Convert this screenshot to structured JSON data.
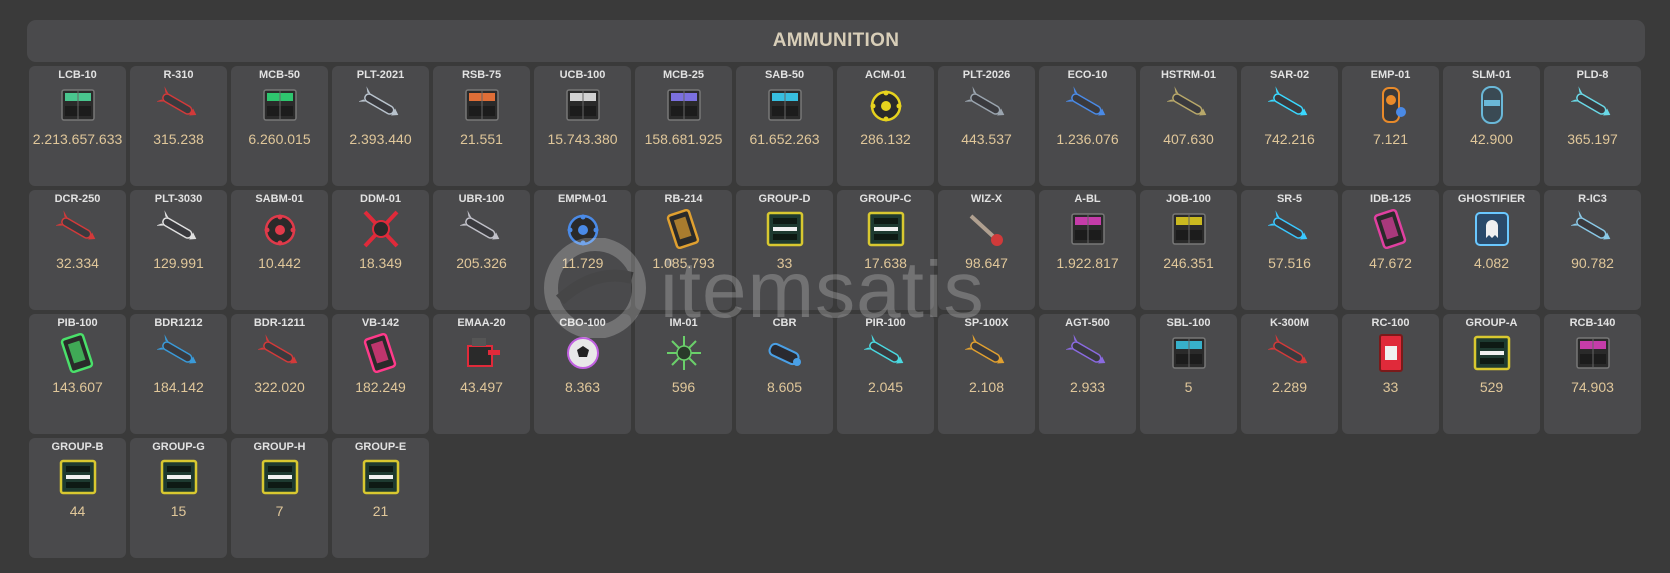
{
  "panel": {
    "title": "AMMUNITION"
  },
  "watermark": {
    "logo": "itemsatis-logo",
    "text": "itemsatis"
  },
  "colors": {
    "background": "#3a3a3a",
    "panel": "#4a4a4c",
    "title": "#d8ceb8",
    "item_name": "#e2e2e2",
    "quantity": "#e0c79a"
  },
  "items": [
    {
      "name": "LCB-10",
      "qty": "2.213.657.633",
      "icon": "crate-icon",
      "color": "#4fe0a0"
    },
    {
      "name": "R-310",
      "qty": "315.238",
      "icon": "missile-icon",
      "color": "#d23a3a"
    },
    {
      "name": "MCB-50",
      "qty": "6.260.015",
      "icon": "crate-icon",
      "color": "#2fe07a"
    },
    {
      "name": "PLT-2021",
      "qty": "2.393.440",
      "icon": "missile-icon",
      "color": "#b8c2cc"
    },
    {
      "name": "RSB-75",
      "qty": "21.551",
      "icon": "crate-icon",
      "color": "#ff7a3a"
    },
    {
      "name": "UCB-100",
      "qty": "15.743.380",
      "icon": "crate-icon",
      "color": "#f0f0f0"
    },
    {
      "name": "MCB-25",
      "qty": "158.681.925",
      "icon": "crate-icon",
      "color": "#8a7cff"
    },
    {
      "name": "SAB-50",
      "qty": "61.652.263",
      "icon": "crate-icon",
      "color": "#3ad8ff"
    },
    {
      "name": "ACM-01",
      "qty": "286.132",
      "icon": "mine-icon",
      "color": "#e6d21e"
    },
    {
      "name": "PLT-2026",
      "qty": "443.537",
      "icon": "missile-icon",
      "color": "#9aa4ae"
    },
    {
      "name": "ECO-10",
      "qty": "1.236.076",
      "icon": "missile-icon",
      "color": "#4a8ae6"
    },
    {
      "name": "HSTRM-01",
      "qty": "407.630",
      "icon": "missile-icon",
      "color": "#b8a86a"
    },
    {
      "name": "SAR-02",
      "qty": "742.216",
      "icon": "missile-icon",
      "color": "#3ad8ff"
    },
    {
      "name": "EMP-01",
      "qty": "7.121",
      "icon": "emp-icon",
      "color": "#e88a2a"
    },
    {
      "name": "SLM-01",
      "qty": "42.900",
      "icon": "capsule-icon",
      "color": "#6ab8d8"
    },
    {
      "name": "PLD-8",
      "qty": "365.197",
      "icon": "missile-icon",
      "color": "#6ad8e6"
    },
    {
      "name": "DCR-250",
      "qty": "32.334",
      "icon": "missile-icon",
      "color": "#d23a3a"
    },
    {
      "name": "PLT-3030",
      "qty": "129.991",
      "icon": "missile-icon",
      "color": "#e0e0e0"
    },
    {
      "name": "SABM-01",
      "qty": "10.442",
      "icon": "mine-icon",
      "color": "#e03a4a"
    },
    {
      "name": "DDM-01",
      "qty": "18.349",
      "icon": "mine-x-icon",
      "color": "#e02a3a"
    },
    {
      "name": "UBR-100",
      "qty": "205.326",
      "icon": "missile-icon",
      "color": "#c0c0c8"
    },
    {
      "name": "EMPM-01",
      "qty": "11.729",
      "icon": "mine-icon",
      "color": "#4a8ae6"
    },
    {
      "name": "RB-214",
      "qty": "1.085.793",
      "icon": "battery-icon",
      "color": "#e0a030"
    },
    {
      "name": "GROUP-D",
      "qty": "33",
      "icon": "box-icon",
      "color": "#d8c830"
    },
    {
      "name": "GROUP-C",
      "qty": "17.638",
      "icon": "box-icon",
      "color": "#d8c830"
    },
    {
      "name": "WIZ-X",
      "qty": "98.647",
      "icon": "wand-icon",
      "color": "#d03a3a"
    },
    {
      "name": "A-BL",
      "qty": "1.922.817",
      "icon": "crate-icon",
      "color": "#e040c0"
    },
    {
      "name": "JOB-100",
      "qty": "246.351",
      "icon": "crate-icon",
      "color": "#e6d21e"
    },
    {
      "name": "SR-5",
      "qty": "57.516",
      "icon": "missile-icon",
      "color": "#3ac8ff"
    },
    {
      "name": "IDB-125",
      "qty": "47.672",
      "icon": "battery-icon",
      "color": "#e040a0"
    },
    {
      "name": "GHOSTIFIER",
      "qty": "4.082",
      "icon": "ghost-icon",
      "color": "#6ac8ff"
    },
    {
      "name": "R-IC3",
      "qty": "90.782",
      "icon": "missile-icon",
      "color": "#8ac8e6"
    },
    {
      "name": "PIB-100",
      "qty": "143.607",
      "icon": "battery-icon",
      "color": "#4ae06a"
    },
    {
      "name": "BDR1212",
      "qty": "184.142",
      "icon": "missile-icon",
      "color": "#3a9ad8"
    },
    {
      "name": "BDR-1211",
      "qty": "322.020",
      "icon": "missile-icon",
      "color": "#d23a3a"
    },
    {
      "name": "VB-142",
      "qty": "182.249",
      "icon": "battery-icon",
      "color": "#ff3a8a"
    },
    {
      "name": "EMAA-20",
      "qty": "43.497",
      "icon": "turret-icon",
      "color": "#e02a3a"
    },
    {
      "name": "CBO-100",
      "qty": "8.363",
      "icon": "ball-icon",
      "color": "#c060e0"
    },
    {
      "name": "IM-01",
      "qty": "596",
      "icon": "spiky-mine-icon",
      "color": "#6ad06a"
    },
    {
      "name": "CBR",
      "qty": "8.605",
      "icon": "rocket-icon",
      "color": "#4aa0e6"
    },
    {
      "name": "PIR-100",
      "qty": "2.045",
      "icon": "missile-icon",
      "color": "#4ad8e0"
    },
    {
      "name": "SP-100X",
      "qty": "2.108",
      "icon": "missile-icon",
      "color": "#e0a030"
    },
    {
      "name": "AGT-500",
      "qty": "2.933",
      "icon": "missile-icon",
      "color": "#8a6ae0"
    },
    {
      "name": "SBL-100",
      "qty": "5",
      "icon": "crate-icon",
      "color": "#3ac8e6"
    },
    {
      "name": "K-300M",
      "qty": "2.289",
      "icon": "missile-icon",
      "color": "#d23a3a"
    },
    {
      "name": "RC-100",
      "qty": "33",
      "icon": "card-icon",
      "color": "#e02a3a"
    },
    {
      "name": "GROUP-A",
      "qty": "529",
      "icon": "box-icon",
      "color": "#d8c830"
    },
    {
      "name": "RCB-140",
      "qty": "74.903",
      "icon": "crate-icon",
      "color": "#e040c0"
    },
    {
      "name": "GROUP-B",
      "qty": "44",
      "icon": "box-icon",
      "color": "#d8c830"
    },
    {
      "name": "GROUP-G",
      "qty": "15",
      "icon": "box-icon",
      "color": "#d8c830"
    },
    {
      "name": "GROUP-H",
      "qty": "7",
      "icon": "box-icon",
      "color": "#d8c830"
    },
    {
      "name": "GROUP-E",
      "qty": "21",
      "icon": "box-icon",
      "color": "#d8c830"
    }
  ]
}
